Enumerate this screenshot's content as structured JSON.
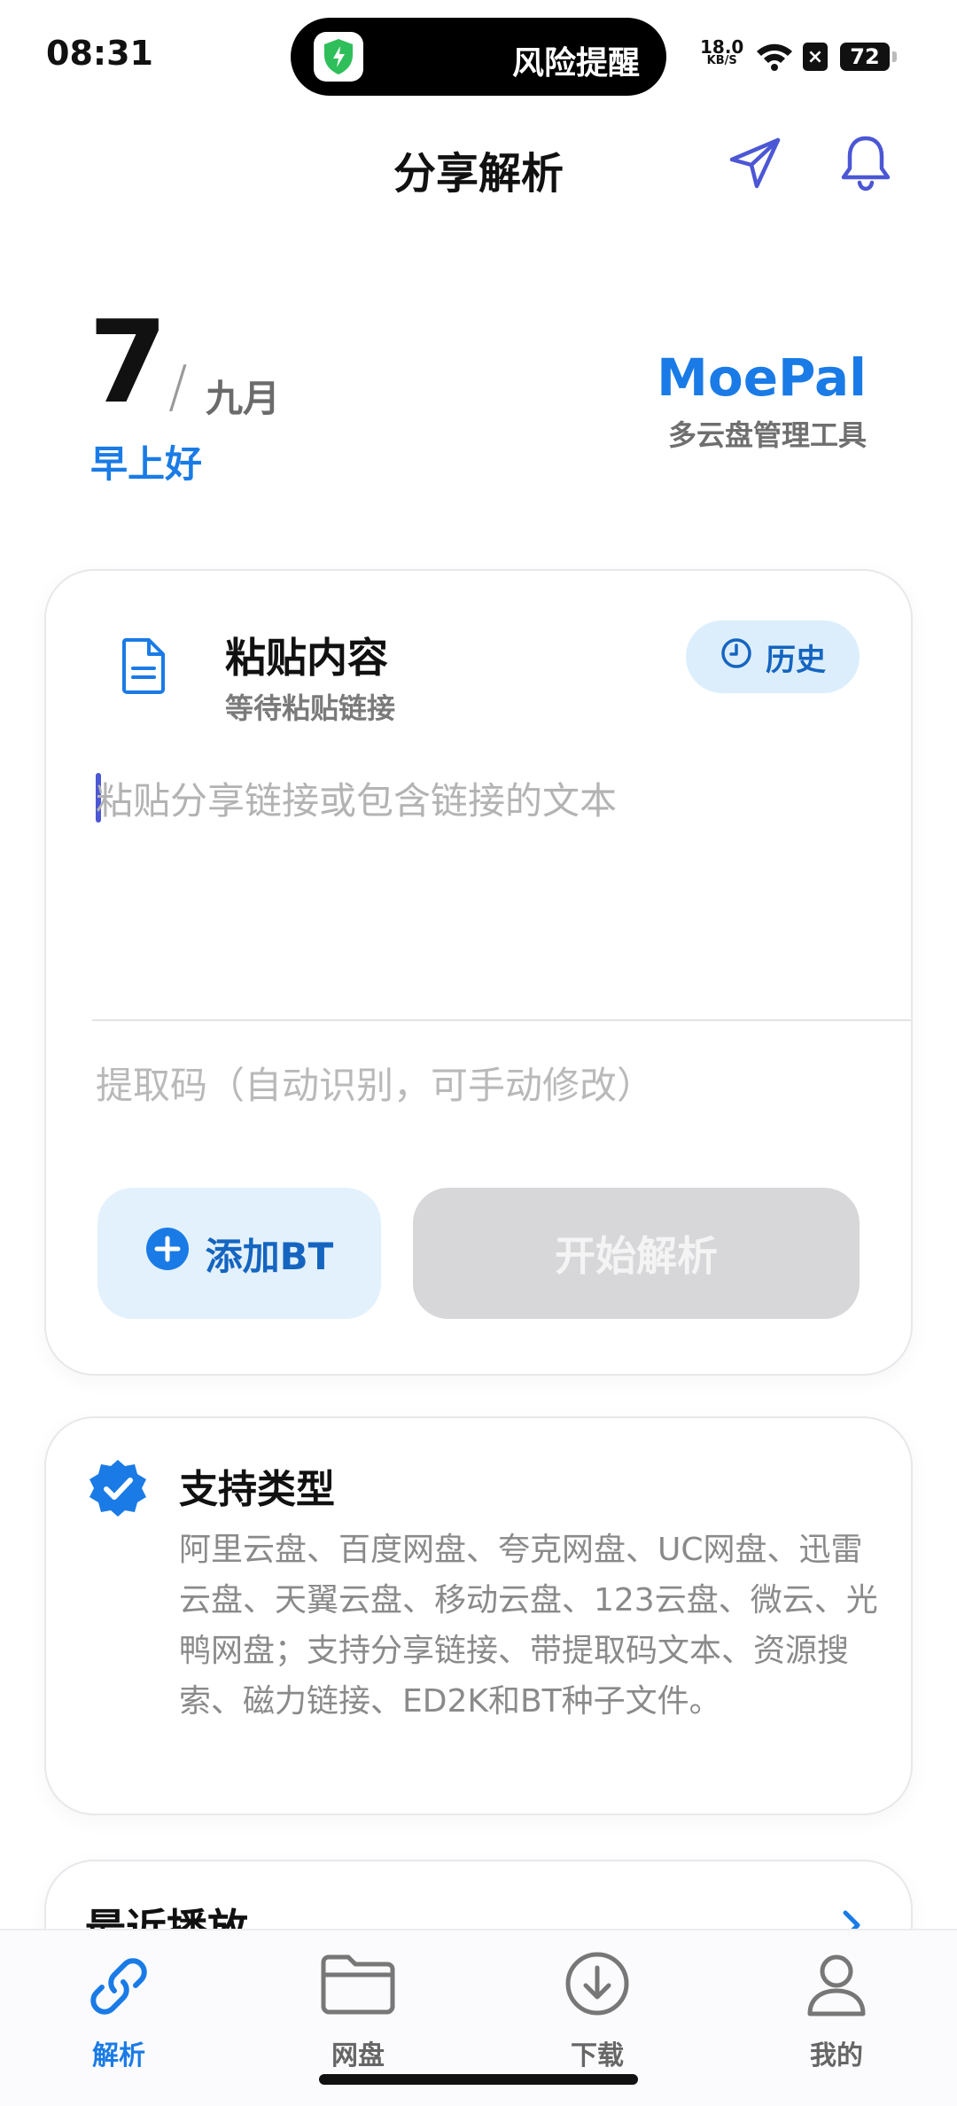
{
  "status_bar": {
    "time": "08:31",
    "island_text": "风险提醒",
    "net_speed_value": "18.0",
    "net_speed_unit": "KB/S",
    "battery": "72"
  },
  "header": {
    "title": "分享解析"
  },
  "date_block": {
    "day": "7",
    "slash": "/",
    "month": "九月",
    "greeting": "早上好",
    "brand": "MoePal",
    "brand_sub": "多云盘管理工具"
  },
  "paste_card": {
    "title": "粘贴内容",
    "subtitle": "等待粘贴链接",
    "history_label": "历史",
    "paste_placeholder": "粘贴分享链接或包含链接的文本",
    "code_placeholder": "提取码（自动识别，可手动修改）",
    "add_bt_label": "添加BT",
    "start_label": "开始解析"
  },
  "support_card": {
    "title": "支持类型",
    "text": "阿里云盘、百度网盘、夸克网盘、UC网盘、迅雷云盘、天翼云盘、移动云盘、123云盘、微云、光鸭网盘；支持分享链接、带提取码文本、资源搜索、磁力链接、ED2K和BT种子文件。"
  },
  "recent_card": {
    "title": "最近播放"
  },
  "bottom_nav": {
    "items": [
      {
        "label": "解析",
        "icon": "link-icon",
        "active": true
      },
      {
        "label": "网盘",
        "icon": "folder-icon",
        "active": false
      },
      {
        "label": "下载",
        "icon": "download-icon",
        "active": false
      },
      {
        "label": "我的",
        "icon": "user-icon",
        "active": false
      }
    ]
  },
  "colors": {
    "accent": "#1a7be6",
    "accent_light": "#e3f1fd",
    "disabled_button": "#d7d7da",
    "icon_purple": "#4b57d4"
  }
}
